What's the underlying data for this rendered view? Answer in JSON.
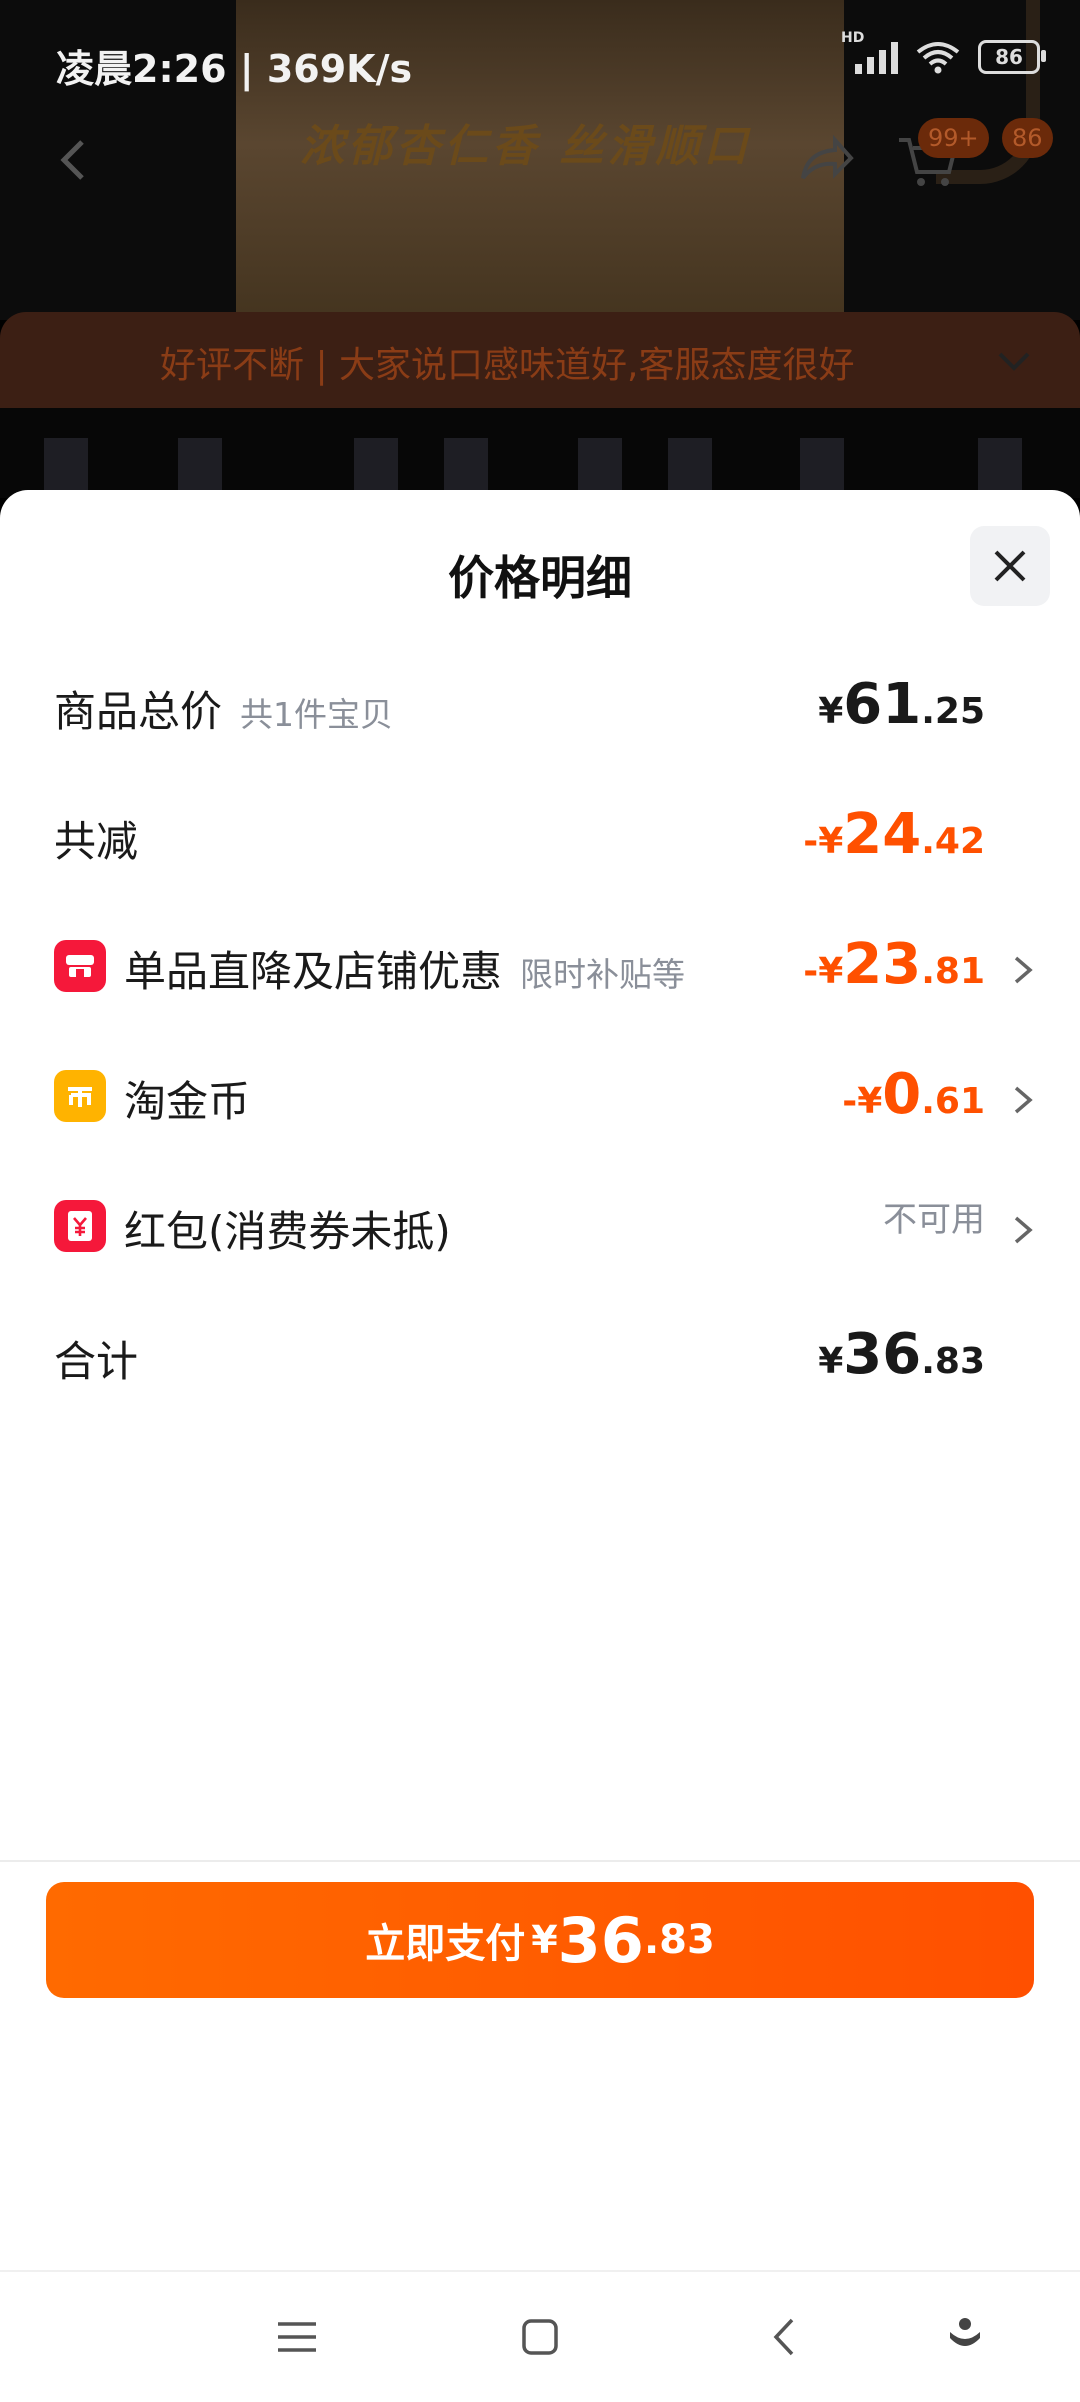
{
  "status_bar": {
    "time_speed": "凌晨2:26 | 369K/s",
    "network_label": "HD",
    "battery": "86"
  },
  "background": {
    "hero_text": "浓郁杏仁香  丝滑顺口",
    "cart_badge": "99+",
    "msg_badge": "86",
    "banner_text": "好评不断 | 大家说口感味道好,客服态度很好"
  },
  "sheet": {
    "title": "价格明细",
    "rows": {
      "total": {
        "label": "商品总价",
        "sub": "共1件宝贝",
        "currency": "¥",
        "int": "61",
        "dec": ".25"
      },
      "reduced": {
        "label": "共减",
        "sign_currency": "-¥",
        "int": "24",
        "dec": ".42"
      },
      "discount": {
        "label": "单品直降及店铺优惠",
        "sub": "限时补贴等",
        "sign_currency": "-¥",
        "int": "23",
        "dec": ".81"
      },
      "coins": {
        "label": "淘金币",
        "sign_currency": "-¥",
        "int": "0",
        "dec": ".61"
      },
      "redpacket": {
        "label": "红包(消费券未抵)",
        "status": "不可用"
      },
      "sum": {
        "label": "合计",
        "currency": "¥",
        "int": "36",
        "dec": ".83"
      }
    },
    "pay": {
      "label": "立即支付",
      "currency": "¥",
      "int": "36",
      "dec": ".83"
    }
  },
  "colors": {
    "accent": "#ff5000",
    "text": "#1a1a1a",
    "muted": "#8a8f99",
    "red_icon": "#f5183a",
    "coin_icon": "#ffb300"
  },
  "icons": [
    "back-icon",
    "share-icon",
    "cart-icon",
    "chevron-down-icon",
    "close-icon",
    "shop-icon",
    "coin-icon",
    "redpacket-icon",
    "chevron-right-icon",
    "menu-icon",
    "home-icon",
    "back-nav-icon",
    "assistant-icon"
  ]
}
